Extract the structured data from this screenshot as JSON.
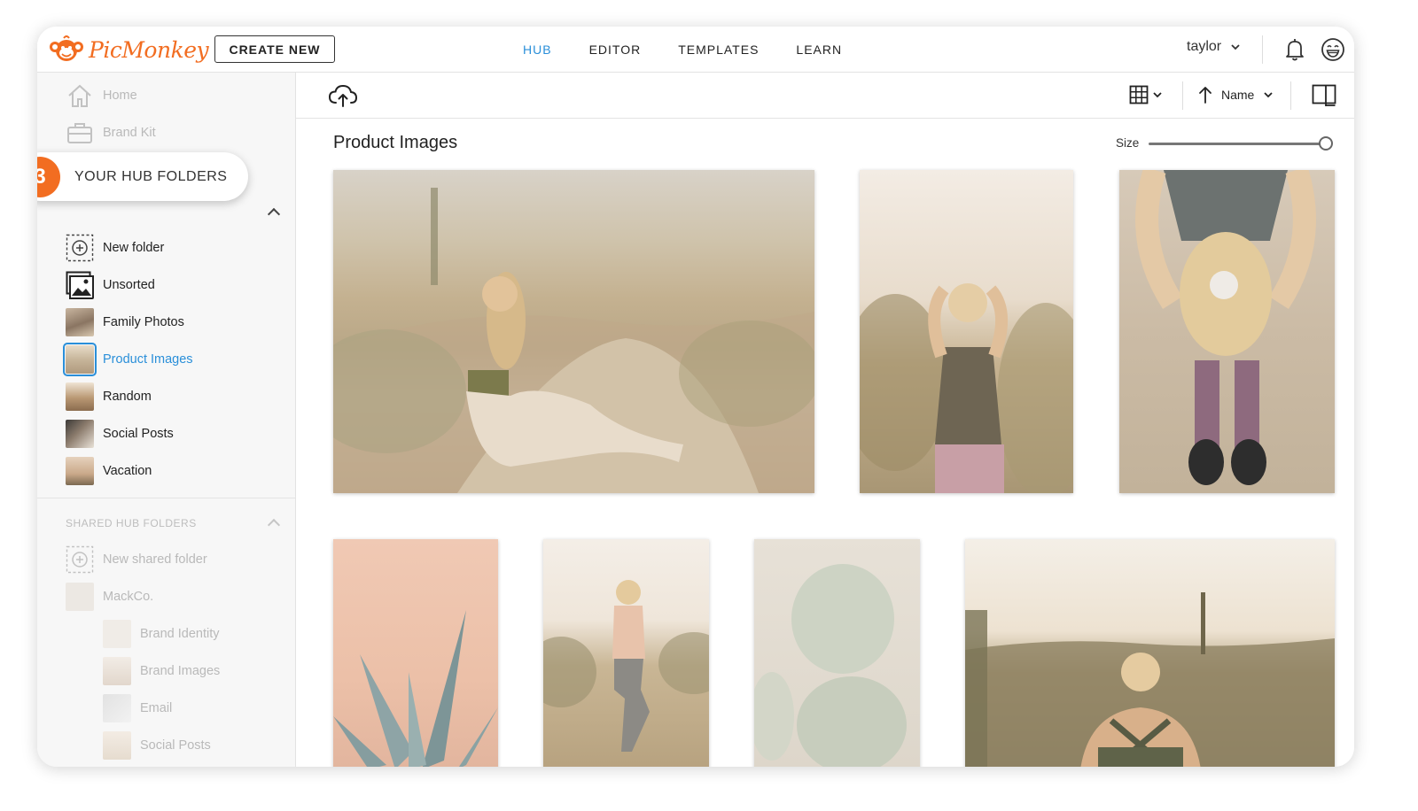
{
  "app": {
    "logo_text": "PicMonkey",
    "create_button": "CREATE NEW",
    "brand_color": "#f26d21",
    "accent_color": "#2a8fd9"
  },
  "nav": {
    "items": [
      {
        "label": "HUB",
        "active": true
      },
      {
        "label": "EDITOR",
        "active": false
      },
      {
        "label": "TEMPLATES",
        "active": false
      },
      {
        "label": "LEARN",
        "active": false
      }
    ]
  },
  "user": {
    "name": "taylor",
    "icons": [
      "chevron-down-icon",
      "bell-icon",
      "smiley-icon"
    ]
  },
  "sidebar": {
    "top_items": [
      {
        "label": "Home",
        "icon": "home-icon"
      },
      {
        "label": "Brand Kit",
        "icon": "briefcase-icon"
      }
    ],
    "your_folders_label": "YOUR HUB FOLDERS",
    "folders": [
      {
        "label": "New folder",
        "icon": "add-folder-icon"
      },
      {
        "label": "Unsorted",
        "icon": "photos-icon"
      },
      {
        "label": "Family Photos"
      },
      {
        "label": "Product Images",
        "active": true
      },
      {
        "label": "Random"
      },
      {
        "label": "Social Posts"
      },
      {
        "label": "Vacation"
      }
    ],
    "shared_label": "SHARED HUB FOLDERS",
    "shared_items": [
      {
        "label": "New shared folder",
        "icon": "add-folder-icon"
      },
      {
        "label": "MackCo."
      }
    ],
    "shared_sub_items": [
      {
        "label": "Brand Identity"
      },
      {
        "label": "Brand Images"
      },
      {
        "label": "Email"
      },
      {
        "label": "Social Posts"
      }
    ]
  },
  "callout": {
    "number": "3",
    "text": "YOUR HUB FOLDERS"
  },
  "toolbar": {
    "sort_label": "Name",
    "icons": [
      "cloud-upload-icon",
      "grid-view-icon",
      "sort-arrow-up-icon",
      "details-panel-icon"
    ]
  },
  "main": {
    "folder_title": "Product Images",
    "size_label": "Size",
    "size_value": 1.0
  }
}
